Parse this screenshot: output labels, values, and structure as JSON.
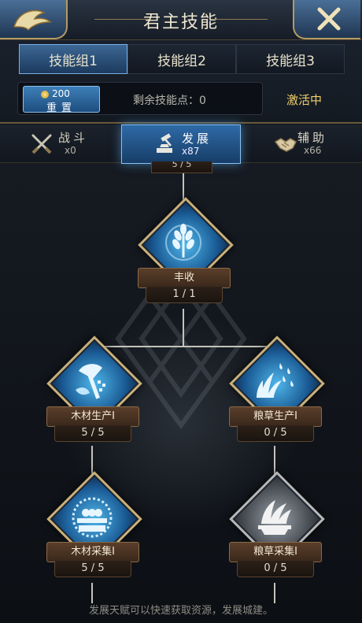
{
  "header": {
    "title": "君主技能",
    "tabs": [
      {
        "label": "技能组1",
        "active": true
      },
      {
        "label": "技能组2",
        "active": false
      },
      {
        "label": "技能组3",
        "active": false
      }
    ],
    "reset": {
      "cost": "200",
      "label": "重置"
    },
    "remaining_points": "剩余技能点：0",
    "status": "激活中"
  },
  "categories": [
    {
      "name": "战斗",
      "count": "x0",
      "icon": "crossed-swords-icon",
      "active": false
    },
    {
      "name": "发展",
      "count": "x87",
      "icon": "hammer-anvil-icon",
      "active": true
    },
    {
      "name": "辅助",
      "count": "x66",
      "icon": "handshake-icon",
      "active": false
    }
  ],
  "tree": {
    "top_level": "5 / 5",
    "skills": [
      {
        "name": "丰收",
        "level": "1 / 1",
        "icon": "wheat-icon",
        "state": "active"
      },
      {
        "name": "木材生产I",
        "level": "5 / 5",
        "icon": "axe-icon",
        "state": "active"
      },
      {
        "name": "粮草生产I",
        "level": "0 / 5",
        "icon": "rain-grain-icon",
        "state": "active"
      },
      {
        "name": "木材采集I",
        "level": "5 / 5",
        "icon": "log-cart-icon",
        "state": "active"
      },
      {
        "name": "粮草采集I",
        "level": "0 / 5",
        "icon": "grain-bowl-icon",
        "state": "locked"
      }
    ]
  },
  "footer_hint": "发展天赋可以快速获取资源，发展城建。",
  "colors": {
    "accent_blue": "#2e6aa7",
    "gold_border": "#c9b07a",
    "status_yellow": "#f0cf6a"
  }
}
